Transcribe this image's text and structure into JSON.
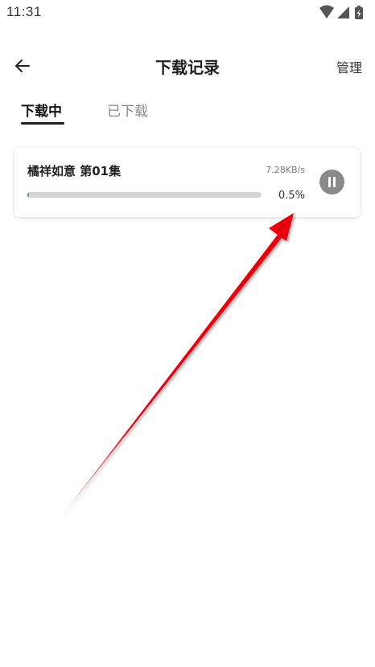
{
  "status_bar": {
    "time": "11:31"
  },
  "header": {
    "title": "下载记录",
    "manage_label": "管理"
  },
  "tabs": [
    {
      "label": "下载中",
      "active": true
    },
    {
      "label": "已下载",
      "active": false
    }
  ],
  "downloads": [
    {
      "title": "橘祥如意 第01集",
      "speed": "7.28KB/s",
      "percent_text": "0.5%",
      "progress": 0.005
    }
  ],
  "colors": {
    "progress": "#2fb58a",
    "annotation_arrow": "#e8000b",
    "pause_button": "#8a8a8a"
  },
  "icons": {
    "back": "arrow-left-icon",
    "wifi": "wifi-icon",
    "signal": "cell-signal-icon",
    "battery": "battery-icon",
    "pause": "pause-icon"
  }
}
